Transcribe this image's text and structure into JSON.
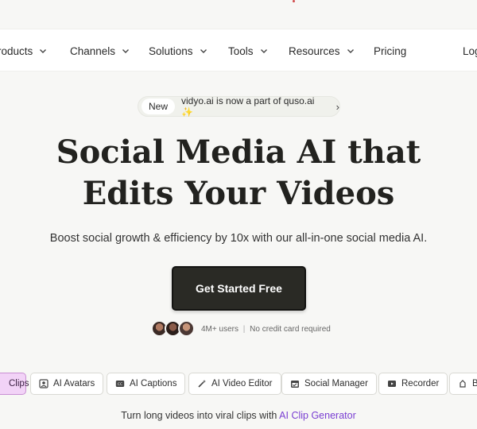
{
  "nav": {
    "items": [
      {
        "label": "Products",
        "shown": "roducts",
        "dropdown": true
      },
      {
        "label": "Channels",
        "dropdown": true
      },
      {
        "label": "Solutions",
        "dropdown": true
      },
      {
        "label": "Tools",
        "dropdown": true
      },
      {
        "label": "Resources",
        "dropdown": true
      },
      {
        "label": "Pricing",
        "dropdown": false
      },
      {
        "label": "Log",
        "dropdown": false
      }
    ]
  },
  "announcement": {
    "badge": "New",
    "message": "vidyo.ai is now a part of quso.ai ✨",
    "arrow": "›"
  },
  "hero": {
    "headline_line1": "Social Media AI that",
    "headline_line2": "Edits Your Videos",
    "subline": "Boost social growth & efficiency by 10x with our all-in-one social media AI.",
    "cta_label": "Get Started Free"
  },
  "social_proof": {
    "users": "4M+ users",
    "separator": "|",
    "note": "No credit card required"
  },
  "feature_tabs": [
    {
      "label": "Clips",
      "icon": "clips-icon",
      "active": true
    },
    {
      "label": "AI Avatars",
      "icon": "avatar-icon",
      "active": false
    },
    {
      "label": "AI Captions",
      "icon": "captions-icon",
      "active": false
    },
    {
      "label": "AI Video Editor",
      "icon": "magic-wand-icon",
      "active": false
    },
    {
      "label": "Social Manager",
      "icon": "calendar-icon",
      "active": false
    },
    {
      "label": "Recorder",
      "icon": "record-icon",
      "active": false
    },
    {
      "label": "Br",
      "icon": "brand-icon",
      "active": false
    }
  ],
  "tagline": {
    "prefix": "Turn long videos into viral clips with ",
    "link": "AI Clip Generator"
  },
  "colors": {
    "background": "#f7f7f5",
    "cta": "#2a2a25",
    "active_chip": "#f2d3f7",
    "link": "#7a3fd2"
  }
}
